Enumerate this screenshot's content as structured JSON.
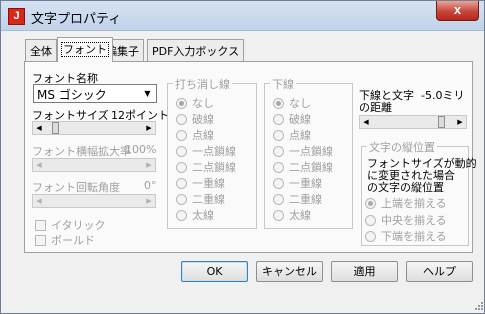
{
  "window": {
    "title": "文字プロパティ",
    "icon": "J",
    "close": "x"
  },
  "tabs": [
    {
      "label": "全体"
    },
    {
      "label": "フォント"
    },
    {
      "label": "編集子"
    },
    {
      "label": "PDF入力ボックス"
    }
  ],
  "font": {
    "name_label": "フォント名称",
    "name_value": "MS ゴシック",
    "size_label": "フォントサイズ",
    "size_value": "12ポイント",
    "width_label": "フォント横幅拡大率",
    "width_value": "100%",
    "rotation_label": "フォント回転角度",
    "rotation_value": "0°",
    "italic_label": "イタリック",
    "bold_label": "ボールド"
  },
  "strikethrough": {
    "title": "打ち消し線",
    "options": [
      "なし",
      "破線",
      "点線",
      "一点鎖線",
      "二点鎖線",
      "一重線",
      "二重線",
      "太線"
    ],
    "selected_index": 0
  },
  "underline": {
    "title": "下線",
    "options": [
      "なし",
      "破線",
      "点線",
      "一点鎖線",
      "二点鎖線",
      "一重線",
      "二重線",
      "太線"
    ],
    "selected_index": 0
  },
  "distance": {
    "label_line1": "下線と文字",
    "label_line2": "の距離",
    "value": "-5.0ミリ"
  },
  "vertical_position": {
    "title": "文字の縦位置",
    "description_line1": "フォントサイズが動的",
    "description_line2": "に変更された場合",
    "description_line3": "の文字の縦位置",
    "options": [
      "上端を揃える",
      "中央を揃える",
      "下端を揃える"
    ],
    "selected_index": 0
  },
  "buttons": {
    "ok": "OK",
    "cancel": "キャンセル",
    "apply": "適用",
    "help": "ヘルプ"
  }
}
